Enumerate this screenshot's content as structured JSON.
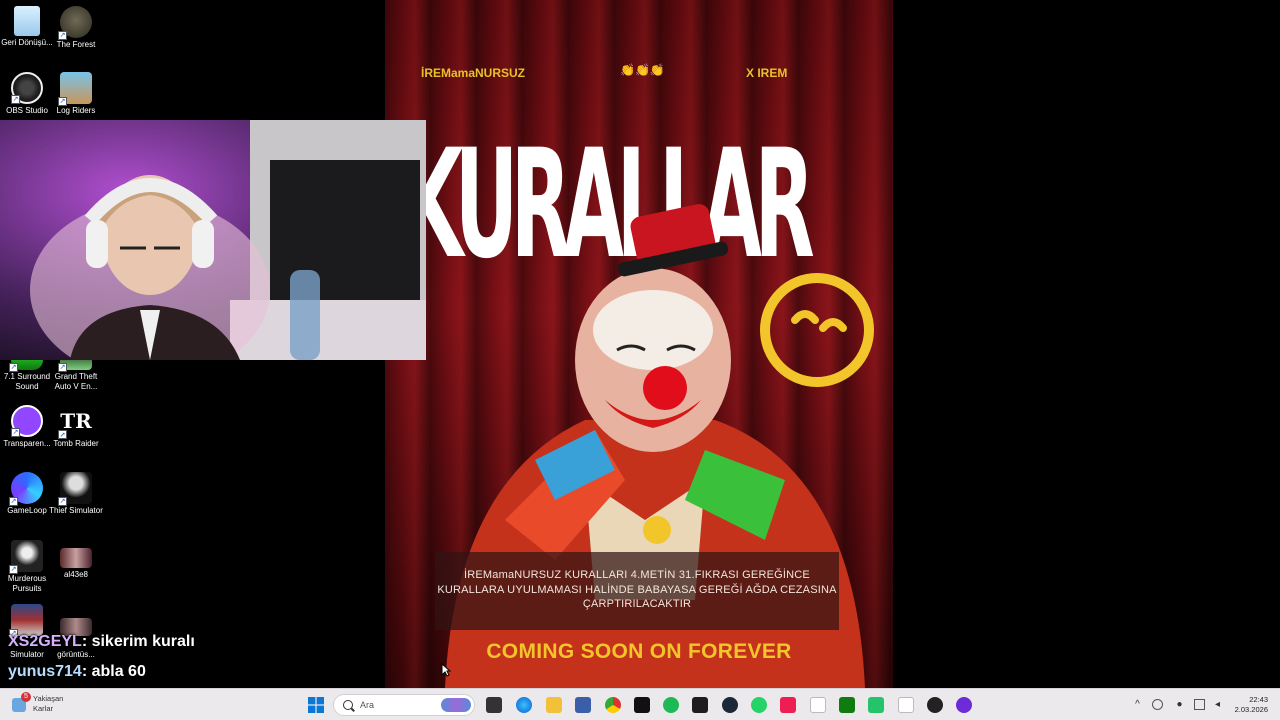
{
  "desktop_icons": [
    {
      "label": "Geri Dönüşü...",
      "icon": "recycle-bin-icon"
    },
    {
      "label": "The Forest",
      "icon": "the-forest-icon"
    },
    {
      "label": "OBS Studio",
      "icon": "obs-studio-icon"
    },
    {
      "label": "Log Riders",
      "icon": "log-riders-icon"
    },
    {
      "label": "7.1 Surround Sound",
      "icon": "surround-sound-icon"
    },
    {
      "label": "Grand Theft Auto V En...",
      "icon": "gta-v-icon"
    },
    {
      "label": "Transparen...",
      "icon": "transparent-chat-icon"
    },
    {
      "label": "Tomb Raider",
      "icon": "tomb-raider-icon"
    },
    {
      "label": "GameLoop",
      "icon": "gameloop-icon"
    },
    {
      "label": "Thief Simulator",
      "icon": "thief-simulator-icon"
    },
    {
      "label": "Murderous Pursuits",
      "icon": "murderous-pursuits-icon"
    },
    {
      "label": "al43e8",
      "icon": "image-file-icon"
    },
    {
      "label": "Simulator",
      "icon": "simulator-icon"
    },
    {
      "label": "görüntüs...",
      "icon": "screenshot-icon"
    }
  ],
  "poster": {
    "top_left": "İREMamaNURSUZ",
    "top_center": "👏👏👏",
    "top_right": "X IREM",
    "title": "KURALLAR",
    "caption": "İREMamaNURSUZ KURALLARI 4.METİN 31.FIKRASI GEREĞİNCE KURALLARA UYULMAMASI HALİNDE BABAYASA GEREĞİ AĞDA CEZASINA ÇARPTIRILACAKTIR",
    "coming": "COMING SOON ON FOREVER"
  },
  "chat": [
    {
      "user": "XS2GEYL",
      "message": ": sikerim kuralı"
    },
    {
      "user": "yunus714",
      "message": ": abla 60"
    }
  ],
  "taskbar": {
    "weather_badge": "5",
    "weather_line1": "Yakiaşan",
    "weather_line2": "Karlar",
    "search_placeholder": "Ara",
    "time": "22:43",
    "date": "2.03.2026"
  },
  "colors": {
    "poster_yellow": "#f2c62a",
    "curtain_red": "#7a1016",
    "taskbar_bg": "#ece9ec"
  }
}
